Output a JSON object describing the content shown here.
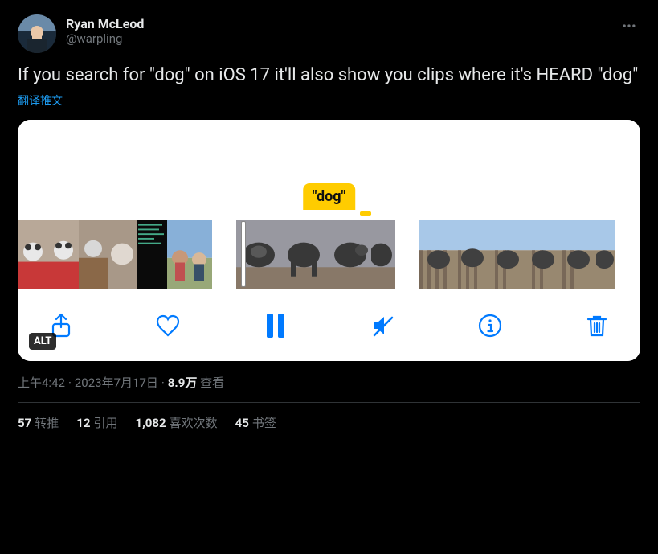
{
  "author": {
    "display_name": "Ryan McLeod",
    "handle": "@warpling"
  },
  "tweet_text": "If you search for \"dog\" on iOS 17 it'll also show you clips where it's HEARD \"dog\"",
  "translate_label": "翻译推文",
  "media": {
    "badge_text": "\"dog\"",
    "alt_label": "ALT"
  },
  "toolbar": {
    "share": "share",
    "like": "like",
    "pause": "pause",
    "mute": "mute",
    "info": "info",
    "trash": "trash"
  },
  "meta": {
    "time": "上午4:42",
    "date": "2023年7月17日",
    "views_count": "8.9万",
    "views_label": "查看"
  },
  "stats": {
    "retweets_count": "57",
    "retweets_label": "转推",
    "quotes_count": "12",
    "quotes_label": "引用",
    "likes_count": "1,082",
    "likes_label": "喜欢次数",
    "bookmarks_count": "45",
    "bookmarks_label": "书签"
  }
}
